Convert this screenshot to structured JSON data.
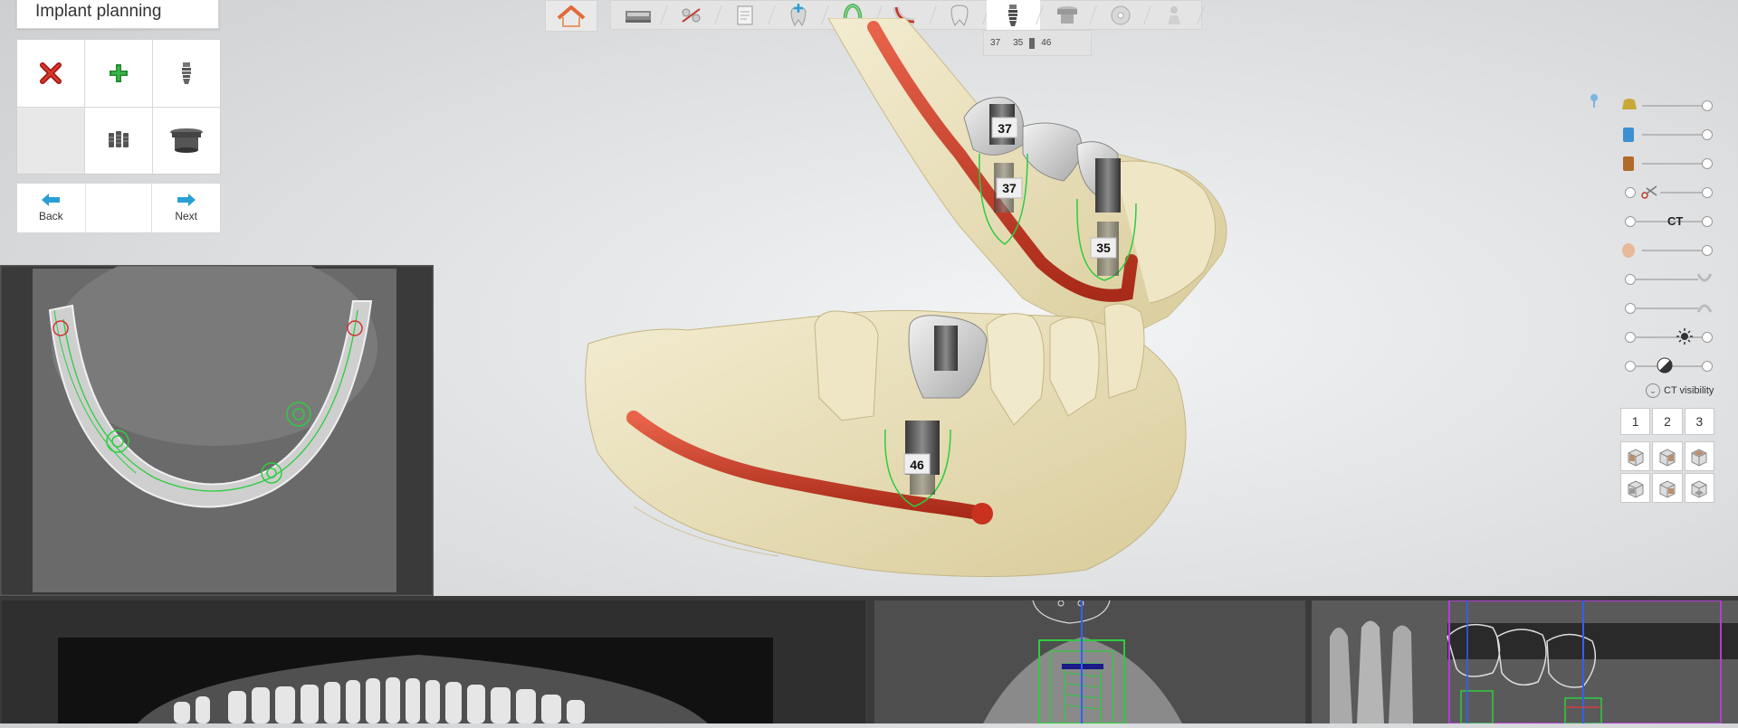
{
  "app": {
    "title": "Implant planning"
  },
  "tools": [
    {
      "name": "delete-implant-button",
      "icon": "red-x-icon"
    },
    {
      "name": "add-implant-button",
      "icon": "green-plus-icon"
    },
    {
      "name": "implant-library-button",
      "icon": "implant-icon"
    },
    {
      "name": "empty-cell",
      "icon": ""
    },
    {
      "name": "multiple-implants-button",
      "icon": "implants-group-icon"
    },
    {
      "name": "sleeve-button",
      "icon": "sleeve-icon"
    }
  ],
  "nav": {
    "back_label": "Back",
    "next_label": "Next"
  },
  "toolbar": {
    "items": [
      "scan-icon",
      "segment-icon",
      "document-icon",
      "tooth-add-icon",
      "arch-icon",
      "nerve-icon",
      "tooth-icon",
      "implant-icon",
      "sleeve-icon",
      "disc-icon",
      "person-icon"
    ],
    "active_index": 7,
    "sub_tabs": [
      "37",
      "35",
      "46"
    ]
  },
  "scene": {
    "implant_labels": [
      "37",
      "37",
      "35",
      "46"
    ]
  },
  "visibility": {
    "ct_label": "CT",
    "ct_visibility_label": "CT visibility",
    "view_numbers": [
      "1",
      "2",
      "3"
    ]
  },
  "colors": {
    "accent_blue": "#2a9fd6",
    "nerve_red": "#c8321e",
    "bone": "#e9dfb8",
    "implant_outline": "#2ecc40"
  }
}
